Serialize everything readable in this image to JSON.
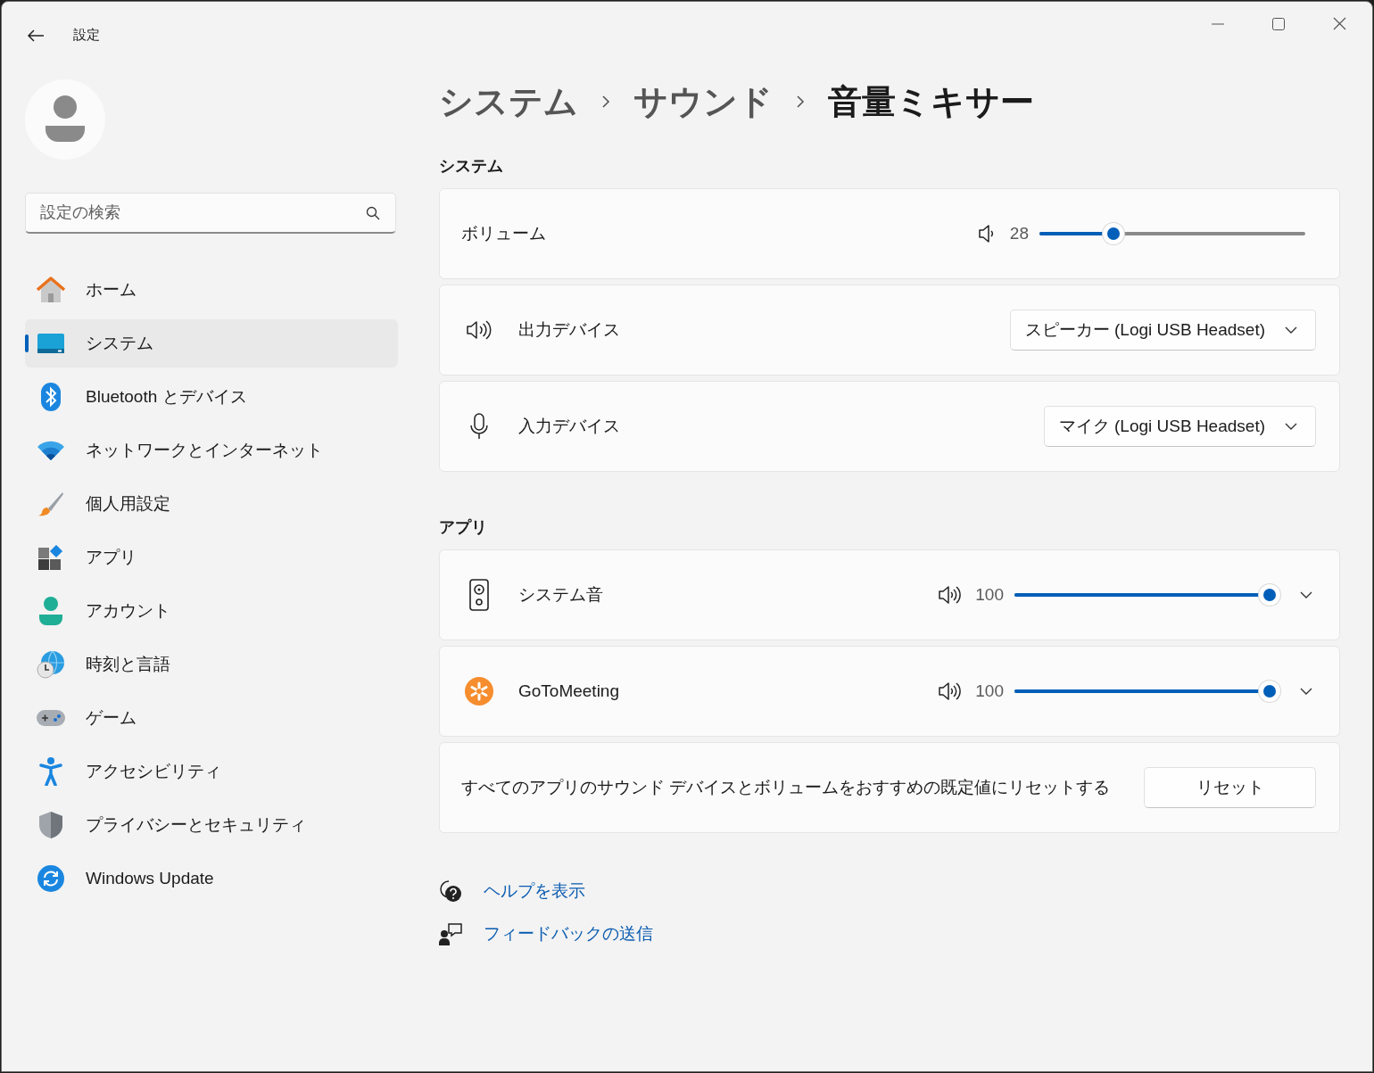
{
  "window": {
    "title": "設定"
  },
  "search": {
    "placeholder": "設定の検索"
  },
  "nav": [
    {
      "label": "ホーム",
      "selected": false
    },
    {
      "label": "システム",
      "selected": true
    },
    {
      "label": "Bluetooth とデバイス",
      "selected": false
    },
    {
      "label": "ネットワークとインターネット",
      "selected": false
    },
    {
      "label": "個人用設定",
      "selected": false
    },
    {
      "label": "アプリ",
      "selected": false
    },
    {
      "label": "アカウント",
      "selected": false
    },
    {
      "label": "時刻と言語",
      "selected": false
    },
    {
      "label": "ゲーム",
      "selected": false
    },
    {
      "label": "アクセシビリティ",
      "selected": false
    },
    {
      "label": "プライバシーとセキュリティ",
      "selected": false
    },
    {
      "label": "Windows Update",
      "selected": false
    }
  ],
  "breadcrumb": [
    "システム",
    "サウンド",
    "音量ミキサー"
  ],
  "sections": [
    {
      "title": "システム",
      "rows": [
        {
          "kind": "slider",
          "label": "ボリューム",
          "value": "28",
          "level": 0.28
        },
        {
          "kind": "dropdown",
          "label": "出力デバイス",
          "value": "スピーカー (Logi USB Headset)"
        },
        {
          "kind": "dropdown",
          "label": "入力デバイス",
          "value": "マイク (Logi USB Headset)"
        }
      ]
    },
    {
      "title": "アプリ",
      "rows": [
        {
          "kind": "app",
          "label": "システム音",
          "value": "100",
          "level": 1.0,
          "expanded": false
        },
        {
          "kind": "app",
          "label": "GoToMeeting",
          "value": "100",
          "level": 1.0,
          "expanded": false
        },
        {
          "kind": "button",
          "label": "すべてのアプリのサウンド デバイスとボリュームをおすすめの既定値にリセットする",
          "button": "リセット"
        }
      ]
    }
  ],
  "links": [
    {
      "label": "ヘルプを表示"
    },
    {
      "label": "フィードバックの送信"
    }
  ]
}
